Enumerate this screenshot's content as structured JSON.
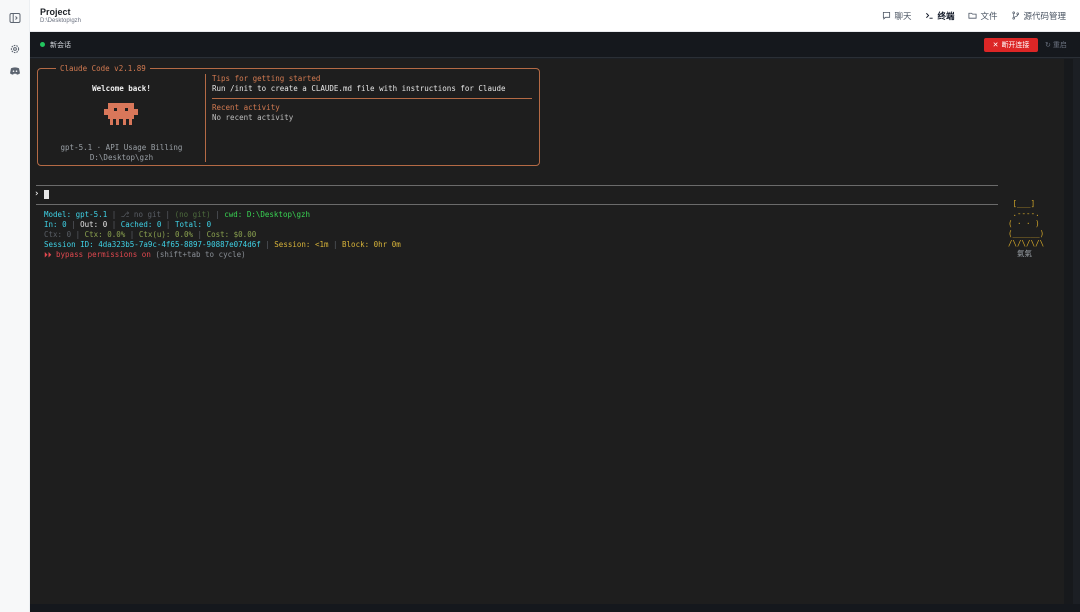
{
  "header": {
    "project_title": "Project",
    "project_path": "D:\\Desktop\\gzh",
    "tabs": [
      {
        "label": "聊天",
        "icon": "chat-icon"
      },
      {
        "label": "终端",
        "icon": "terminal-icon",
        "active": true
      },
      {
        "label": "文件",
        "icon": "folder-icon"
      },
      {
        "label": "源代码管理",
        "icon": "git-branch-icon"
      }
    ]
  },
  "rail": {
    "icons": [
      "sidebar-toggle-icon",
      "settings-icon",
      "discord-icon"
    ]
  },
  "terminal_bar": {
    "session_label": "新会话",
    "disconnect_label": "断开连接",
    "reconnect_label": "重启"
  },
  "welcome_box": {
    "title": "Claude Code v2.1.89",
    "welcome": "Welcome back!",
    "model_line": "gpt-5.1 · API Usage Billing",
    "cwd": "D:\\Desktop\\gzh",
    "tips_heading": "Tips for getting started",
    "tips_text": "Run /init to create a CLAUDE.md file with instructions for Claude",
    "recent_heading": "Recent activity",
    "recent_text": "No recent activity"
  },
  "prompt": {
    "symbol": "›"
  },
  "statusline": {
    "model_label": "Model:",
    "model_value": "gpt-5.1",
    "git_segment": "⎇ no git",
    "no_git": "(no git)",
    "cwd_label": "cwd:",
    "cwd_value": "D:\\Desktop\\gzh",
    "in_label": "In:",
    "in_value": "0",
    "out_label": "Out:",
    "out_value": "0",
    "cached_label": "Cached:",
    "cached_value": "0",
    "total_label": "Total:",
    "total_value": "0",
    "ctx_label": "Ctx:",
    "ctx_value": "0",
    "ctx_pct_label": "Ctx:",
    "ctx_pct_value": "0.0%",
    "ctxu_label": "Ctx(u):",
    "ctxu_value": "0.0%",
    "cost_label": "Cost:",
    "cost_value": "$0.00",
    "session_label": "Session ID:",
    "session_value": "4da323b5-7a9c-4f65-8897-90887e074d6f",
    "session2_label": "Session:",
    "session2_value": "<1m",
    "block_label": "Block:",
    "block_value": "0hr 0m",
    "bypass_arrows": "⏵⏵",
    "bypass_text": "bypass permissions on",
    "bypass_hint": "(shift+tab to cycle)"
  },
  "ascii_pet": {
    "lines": [
      " [___]",
      " .----.",
      "( · · )",
      "(______)",
      "/\\/\\/\\/\\",
      "  氣氣"
    ]
  },
  "colors": {
    "terminal_bg": "#1e1e1e",
    "accent_orange": "#d27a51",
    "disconnect_red": "#dc2626",
    "status_dot_green": "#22c55e"
  }
}
